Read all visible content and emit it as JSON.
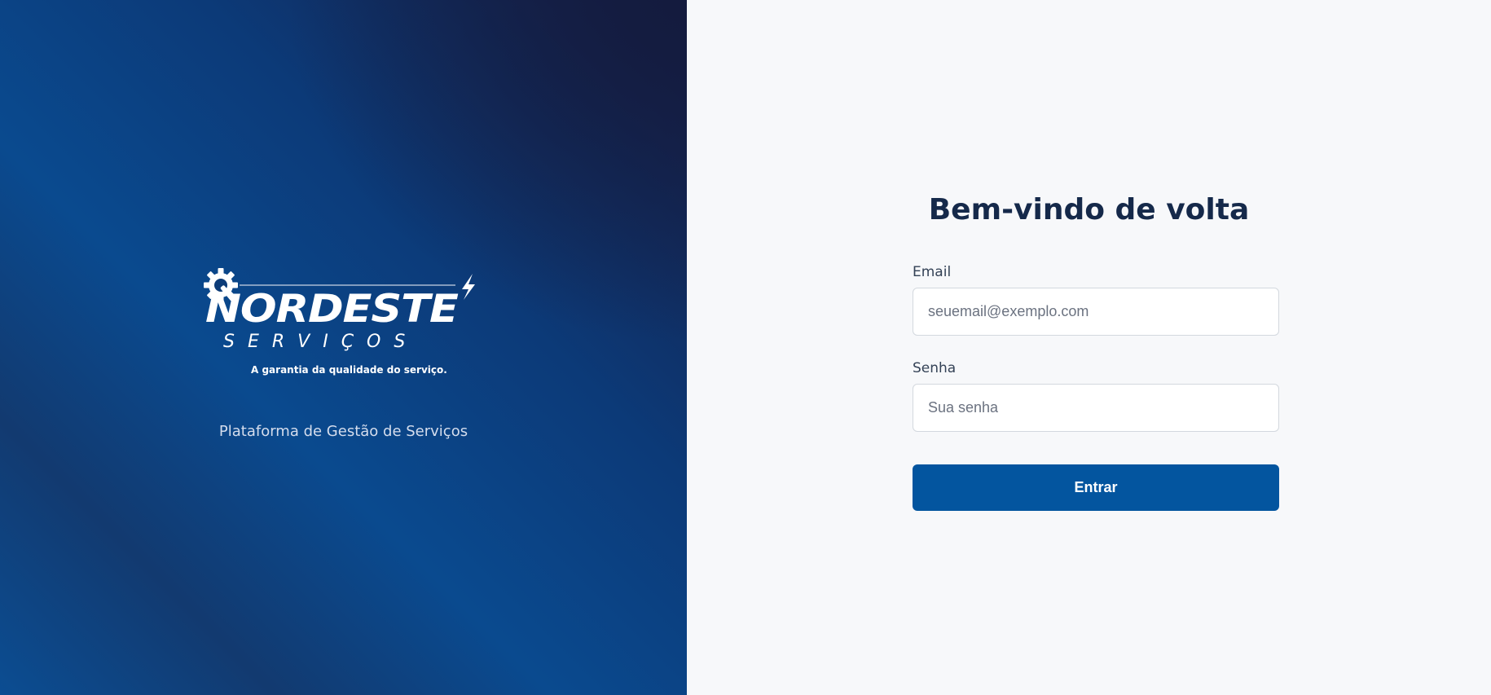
{
  "brand": {
    "name": "NORDESTE",
    "subtitle": "SERVIÇOS",
    "tagline": "A garantia da qualidade do serviço.",
    "platform_label": "Plataforma de Gestão de Serviços",
    "logo_icons": [
      "gear-wrench-icon",
      "lightning-bolt-icon"
    ]
  },
  "login": {
    "title": "Bem-vindo de volta",
    "email_label": "Email",
    "email_placeholder": "seuemail@exemplo.com",
    "email_value": "",
    "password_label": "Senha",
    "password_placeholder": "Sua senha",
    "password_value": "",
    "submit_label": "Entrar"
  },
  "colors": {
    "primary": "#03559f",
    "title": "#15294a",
    "panel_dark": "#161d44",
    "panel_blue": "#0a4a8f",
    "background": "#f7f8fa"
  }
}
